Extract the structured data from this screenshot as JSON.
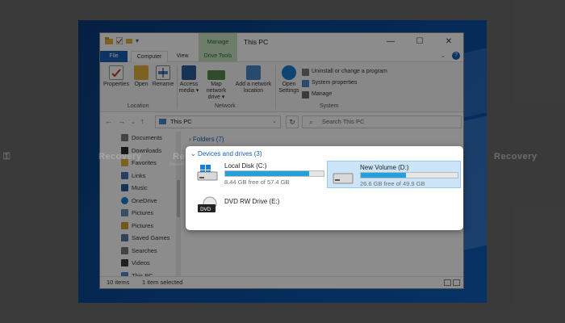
{
  "window": {
    "title": "This PC",
    "context_label": "Manage",
    "controls": {
      "minimize": "—",
      "maximize": "☐",
      "close": "✕"
    }
  },
  "tabs": [
    {
      "label": "File"
    },
    {
      "label": "Computer"
    },
    {
      "label": "View"
    },
    {
      "label": "Drive Tools"
    }
  ],
  "ribbon": {
    "location": {
      "group_label": "Location",
      "buttons": [
        {
          "label": "Properties",
          "icon": "check-properties-icon"
        },
        {
          "label": "Open",
          "icon": "folder-open-icon"
        },
        {
          "label": "Rename",
          "icon": "rename-icon"
        }
      ]
    },
    "network": {
      "group_label": "Network",
      "buttons": [
        {
          "label": "Access media ▾",
          "icon": "media-icon"
        },
        {
          "label": "Map network drive ▾",
          "icon": "network-drive-icon"
        },
        {
          "label": "Add a network location",
          "icon": "network-location-icon"
        }
      ]
    },
    "system": {
      "group_label": "System",
      "open_settings": "Open Settings",
      "items": [
        {
          "label": "Uninstall or change a program"
        },
        {
          "label": "System properties"
        },
        {
          "label": "Manage"
        }
      ]
    }
  },
  "address": {
    "path": "This PC",
    "search_placeholder": "Search This PC"
  },
  "sidebar": {
    "items": [
      {
        "label": "Documents",
        "color": "#7a7a7a"
      },
      {
        "label": "Downloads",
        "color": "#2a2a2a"
      },
      {
        "label": "Favorites",
        "color": "#e2b13c"
      },
      {
        "label": "Links",
        "color": "#4a6fb4"
      },
      {
        "label": "Music",
        "color": "#2a5f9e"
      },
      {
        "label": "OneDrive",
        "color": "#1a7ed6"
      },
      {
        "label": "Pictures",
        "color": "#6a8fb4"
      },
      {
        "label": "Pictures",
        "color": "#d89b3a"
      },
      {
        "label": "Saved Games",
        "color": "#5a7a9e"
      },
      {
        "label": "Searches",
        "color": "#7a7a7a"
      },
      {
        "label": "Videos",
        "color": "#3a3a3a"
      },
      {
        "label": "This PC",
        "color": "#4a88c8"
      }
    ]
  },
  "content": {
    "folders_header": "Folders (7)",
    "devices_header": "Devices and drives (3)",
    "drives": [
      {
        "name": "Local Disk (C:)",
        "free_text": "8.44 GB free of 57.4 GB",
        "used_fraction": 0.853,
        "icon": "windows-drive-icon",
        "selected": false
      },
      {
        "name": "New Volume (D:)",
        "free_text": "26.6 GB free of 49.9 GB",
        "used_fraction": 0.467,
        "icon": "hard-drive-icon",
        "selected": true
      },
      {
        "name": "DVD RW Drive (E:)",
        "icon": "dvd-drive-icon",
        "selected": false
      }
    ]
  },
  "status": {
    "items_count": "10 items",
    "selection": "1 item selected"
  },
  "watermark": {
    "text": "Recovery",
    "subtext": "Recovery Sector Recovery Web"
  },
  "colors": {
    "accent": "#1a5fb4",
    "progress": "#26a0da",
    "selection_bg": "#cce4f7",
    "drive_tools_tab": "#c9e4c1"
  }
}
